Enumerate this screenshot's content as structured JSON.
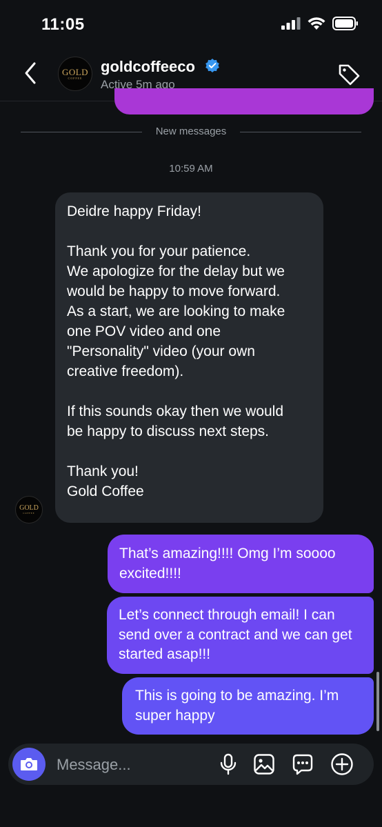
{
  "status_bar": {
    "time": "11:05"
  },
  "header": {
    "username": "goldcoffeeco",
    "activity": "Active 5m ago",
    "avatar_text": "GOLD",
    "avatar_subtext": "COFFEE"
  },
  "divider_label": "New messages",
  "timestamp": "10:59 AM",
  "incoming_message": {
    "lines": [
      "Deidre happy Friday!",
      "",
      "Thank you for your patience.",
      "We apologize for the delay but we",
      "would be happy to move forward.",
      "As a start, we are looking to make",
      "one POV video and one",
      "\"Personality\" video (your own",
      "creative freedom).",
      "",
      "If this sounds okay then we would",
      "be happy to discuss next steps.",
      "",
      "Thank you!",
      "Gold Coffee"
    ]
  },
  "outgoing_messages": [
    "That’s amazing!!!! Omg I’m soooo excited!!!!",
    "Let’s connect through email! I can send over a contract and we can get started asap!!!",
    "This is going to be amazing. I’m super happy"
  ],
  "composer": {
    "placeholder": "Message..."
  },
  "colors": {
    "background": "#0f1114",
    "incoming_bubble": "#262a2f",
    "outgoing_bubble_1": "#7a3fef",
    "outgoing_bubble_2": "#6d48f2",
    "outgoing_bubble_3": "#6253f5",
    "previous_bubble": "#a937d6",
    "camera_button": "#5b5cf0",
    "verified_badge": "#3797f0"
  },
  "icons": {
    "back": "chevron-left-icon",
    "verified": "verified-badge-icon",
    "tag": "tag-icon",
    "camera": "camera-icon",
    "mic": "microphone-icon",
    "gallery": "image-icon",
    "sticker": "message-dots-icon",
    "add": "plus-circle-icon"
  }
}
